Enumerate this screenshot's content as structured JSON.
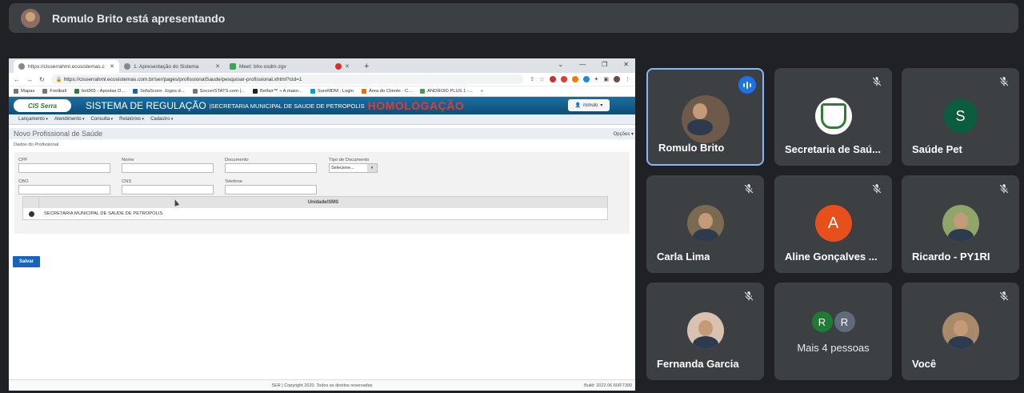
{
  "presenter": {
    "title": "Romulo Brito está apresentando"
  },
  "browser": {
    "tabs": [
      {
        "label": "https://cisserrahml.ecosistemas.c",
        "active": true
      },
      {
        "label": "1. Apresentação do Sistema",
        "active": false
      },
      {
        "label": "Meet: bhx-osdm-zgv",
        "active": false
      }
    ],
    "url": "https://cisserrahml.ecosistemas.com.br/ser/pages/profissionalSaude/pesquisar-profissional.xhtml?cid=1",
    "bookmarks": [
      "Mapas",
      "Football",
      "bet365 - Apostas D...",
      "SofaScore: Jogos d...",
      "SoccerSTATS.com |...",
      "Betfair™ » A maior...",
      "SureMDM : Login",
      "Área do Cliente - C...",
      "ANDROID PLUS 1 -..."
    ]
  },
  "app": {
    "logo": "CIS Serra",
    "system_name": "SISTEMA DE REGULAÇÃO",
    "subtitle": "SECRETARIA MUNICIPAL DE SAUDE DE PETROPOLIS",
    "env": "HOMOLOGAÇÃO",
    "user": "romulo",
    "menu": [
      "Lançamento",
      "Atendimento",
      "Consulta",
      "Relatórios",
      "Cadastro"
    ],
    "page_title": "Novo Profissional de Saúde",
    "options": "Opções ▾",
    "section": "Dados do Profissional",
    "fields": {
      "cpf": "CPF",
      "nome": "Nome",
      "documento": "Documento",
      "tipo_documento": "Tipo de Documento",
      "tipo_documento_value": "Selecione...",
      "cbo": "CBO",
      "cns": "CNS",
      "telefone": "Telefone"
    },
    "unit_table": {
      "header": "Unidade/SMS",
      "rows": [
        "SECRETARIA MUNICIPAL DE SAUDE DE PETROPOLIS"
      ]
    },
    "save_label": "Salvar",
    "footer": "SER | Copyright 2020. Todos os direitos reservados",
    "build": "Build: 2022.06.60/F7390"
  },
  "participants": [
    {
      "name": "Romulo Brito",
      "speaking": true
    },
    {
      "name": "Secretaria de Saú..."
    },
    {
      "name": "Saúde Pet",
      "initial": "S"
    },
    {
      "name": "Carla Lima"
    },
    {
      "name": "Aline Gonçalves ...",
      "initial": "A"
    },
    {
      "name": "Ricardo - PY1RI"
    },
    {
      "name": "Fernanda Garcia"
    },
    {
      "name": "Mais 4 pessoas",
      "initials": [
        "R",
        "R"
      ]
    },
    {
      "name": "Você"
    }
  ],
  "colors": {
    "speaking_border": "#8ab4f8",
    "header_blue": "#0d4f79",
    "homolog_red": "#e53935"
  }
}
